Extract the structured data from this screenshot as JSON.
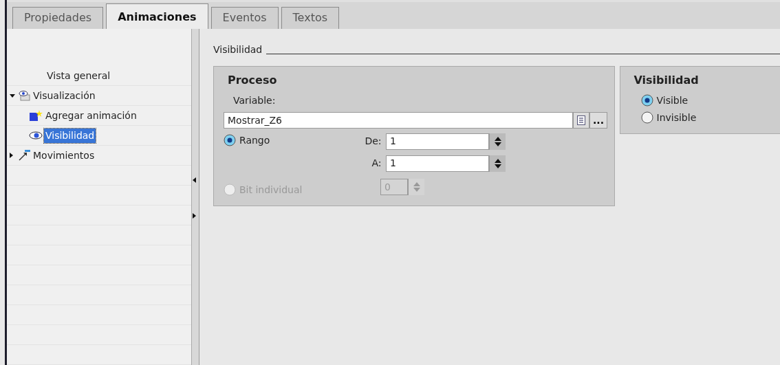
{
  "tabs": [
    {
      "label": "Propiedades",
      "selected": false
    },
    {
      "label": "Animaciones",
      "selected": true
    },
    {
      "label": "Eventos",
      "selected": false
    },
    {
      "label": "Textos",
      "selected": false
    }
  ],
  "tree": [
    {
      "label": "Vista general",
      "kind": "plain"
    },
    {
      "label": "Visualización",
      "kind": "display",
      "expanded": true,
      "children": [
        {
          "label": "Agregar animación",
          "kind": "add",
          "selected": false
        },
        {
          "label": "Visibilidad",
          "kind": "eye",
          "selected": true
        }
      ]
    },
    {
      "label": "Movimientos",
      "kind": "motion",
      "expanded": false
    }
  ],
  "section_title": "Visibilidad",
  "process": {
    "title": "Proceso",
    "variable_label": "Variable:",
    "variable_value": "Mostrar_Z6",
    "browse_label": "...",
    "options": [
      {
        "label": "Rango",
        "selected": true,
        "disabled": false
      },
      {
        "label": "Bit individual",
        "selected": false,
        "disabled": true
      }
    ],
    "from_label": "De:",
    "from_value": "1",
    "to_label": "A:",
    "to_value": "1",
    "bit_value": "0",
    "bit_disabled": true
  },
  "visibility": {
    "title": "Visibilidad",
    "options": [
      {
        "label": "Visible",
        "selected": true
      },
      {
        "label": "Invisible",
        "selected": false
      }
    ]
  }
}
